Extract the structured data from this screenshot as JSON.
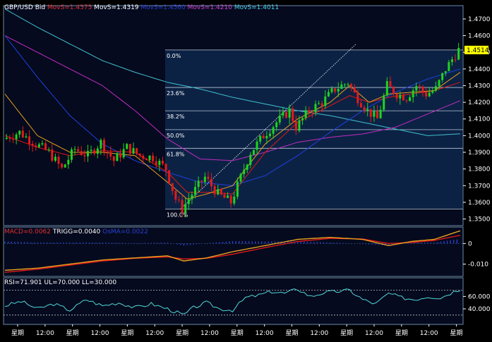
{
  "symbol": "GBP/USD Bid",
  "colors": {
    "background": "#000000",
    "panel_bg": "#050a1e",
    "fib_fill": "#0c2244",
    "grid": "#3a5a7a",
    "border": "#6a8aaa",
    "candle_up": "#1fd41f",
    "candle_down": "#e21b1b",
    "ma_fast": "#e8a020",
    "ma_mid": "#e01818",
    "ma_slow": "#2040e0",
    "ma_magenta": "#c02cc0",
    "ma_cyan": "#40c0d0",
    "macd_line": "#e8a020",
    "trigger_line": "#e01818",
    "osma_hist": "#2a40d0",
    "rsi_line": "#50d8d8",
    "trend_line": "#ffffff",
    "axis_text": "#ffffff",
    "price_tag_bg": "#ffff00"
  },
  "legend": {
    "main": [
      {
        "text": "GBP/USD Bid",
        "color": "#ffffff"
      },
      {
        "text": "MovS=1.4375",
        "color": "#e03030"
      },
      {
        "text": "MovS=1.4319",
        "color": "#ffffff"
      },
      {
        "text": "MovS=1.4560",
        "color": "#2a40d0"
      },
      {
        "text": "MovS=1.4210",
        "color": "#d040d0"
      },
      {
        "text": "MovS=1.4011",
        "color": "#50d0e0"
      }
    ],
    "macd": [
      {
        "text": "MACD=0.0062",
        "color": "#e03030"
      },
      {
        "text": "TRIGG=0.0040",
        "color": "#ffffff"
      },
      {
        "text": "OsMA=0.0022",
        "color": "#2a40d0"
      }
    ],
    "rsi": [
      {
        "text": "RSI=71.901",
        "color": "#ffffff"
      },
      {
        "text": "UL=70.000",
        "color": "#ffffff"
      },
      {
        "text": "LL=30.000",
        "color": "#ffffff"
      }
    ]
  },
  "last_price": "1.4514",
  "fib_levels": [
    {
      "label": "0.0%",
      "value": 1.4514
    },
    {
      "label": "23.6%",
      "value": 1.4289
    },
    {
      "label": "38.2%",
      "value": 1.4149
    },
    {
      "label": "50.0%",
      "value": 1.4036
    },
    {
      "label": "61.8%",
      "value": 1.3924
    },
    {
      "label": "100.0%",
      "value": 1.356
    }
  ],
  "x_axis_labels": [
    "星期",
    "12:00",
    "星期",
    "12:00",
    "星期",
    "12:00",
    "星期",
    "12:00",
    "星期",
    "12:00",
    "星期",
    "12:00",
    "星期",
    "12:00",
    "星期",
    "12:00",
    "星期"
  ],
  "chart_data": [
    {
      "type": "candlestick",
      "name": "price",
      "title": "GBP/USD Bid",
      "ylim": [
        1.346,
        1.478
      ],
      "y_ticks": [
        "1.4700",
        "1.4600",
        "1.4500",
        "1.4400",
        "1.4300",
        "1.4200",
        "1.4100",
        "1.4000",
        "1.3900",
        "1.3800",
        "1.3700",
        "1.3600",
        "1.3500"
      ],
      "bar_count": 130,
      "close_path": [
        [
          0,
          1.398
        ],
        [
          5,
          1.402
        ],
        [
          10,
          1.395
        ],
        [
          14,
          1.39
        ],
        [
          18,
          1.38
        ],
        [
          22,
          1.392
        ],
        [
          26,
          1.388
        ],
        [
          30,
          1.396
        ],
        [
          34,
          1.385
        ],
        [
          38,
          1.393
        ],
        [
          42,
          1.388
        ],
        [
          46,
          1.387
        ],
        [
          50,
          1.38
        ],
        [
          53,
          1.362
        ],
        [
          55,
          1.356
        ],
        [
          58,
          1.365
        ],
        [
          62,
          1.375
        ],
        [
          66,
          1.365
        ],
        [
          70,
          1.36
        ],
        [
          72,
          1.37
        ],
        [
          76,
          1.39
        ],
        [
          80,
          1.4
        ],
        [
          84,
          1.408
        ],
        [
          88,
          1.415
        ],
        [
          90,
          1.405
        ],
        [
          94,
          1.415
        ],
        [
          98,
          1.42
        ],
        [
          102,
          1.428
        ],
        [
          106,
          1.432
        ],
        [
          108,
          1.425
        ],
        [
          112,
          1.415
        ],
        [
          115,
          1.41
        ],
        [
          118,
          1.43
        ],
        [
          121,
          1.425
        ],
        [
          124,
          1.423
        ],
        [
          127,
          1.43
        ],
        [
          130,
          1.425
        ],
        [
          133,
          1.428
        ],
        [
          136,
          1.44
        ],
        [
          140,
          1.4514
        ]
      ],
      "moving_averages": [
        {
          "name": "MovS",
          "value": 1.4375,
          "path": [
            [
              0,
              1.425
            ],
            [
              10,
              1.4
            ],
            [
              20,
              1.39
            ],
            [
              30,
              1.39
            ],
            [
              40,
              1.388
            ],
            [
              50,
              1.372
            ],
            [
              56,
              1.362
            ],
            [
              62,
              1.365
            ],
            [
              70,
              1.37
            ],
            [
              80,
              1.395
            ],
            [
              90,
              1.41
            ],
            [
              100,
              1.42
            ],
            [
              106,
              1.43
            ],
            [
              112,
              1.42
            ],
            [
              118,
              1.425
            ],
            [
              125,
              1.426
            ],
            [
              132,
              1.427
            ],
            [
              140,
              1.438
            ]
          ]
        },
        {
          "name": "MovS",
          "value": 1.4319,
          "path": [
            [
              0,
              1.4
            ],
            [
              10,
              1.393
            ],
            [
              20,
              1.388
            ],
            [
              30,
              1.391
            ],
            [
              40,
              1.39
            ],
            [
              50,
              1.378
            ],
            [
              56,
              1.366
            ],
            [
              62,
              1.366
            ],
            [
              70,
              1.365
            ],
            [
              80,
              1.39
            ],
            [
              90,
              1.408
            ],
            [
              100,
              1.418
            ],
            [
              106,
              1.424
            ],
            [
              112,
              1.42
            ],
            [
              118,
              1.423
            ],
            [
              125,
              1.425
            ],
            [
              132,
              1.427
            ],
            [
              140,
              1.432
            ]
          ]
        },
        {
          "name": "MovS",
          "value": 1.456,
          "path": [
            [
              0,
              1.46
            ],
            [
              10,
              1.435
            ],
            [
              20,
              1.412
            ],
            [
              30,
              1.395
            ],
            [
              40,
              1.385
            ],
            [
              50,
              1.378
            ],
            [
              60,
              1.372
            ],
            [
              70,
              1.37
            ],
            [
              80,
              1.376
            ],
            [
              90,
              1.388
            ],
            [
              100,
              1.402
            ],
            [
              110,
              1.415
            ],
            [
              120,
              1.426
            ],
            [
              130,
              1.434
            ],
            [
              140,
              1.44
            ]
          ]
        },
        {
          "name": "MovS",
          "value": 1.421,
          "path": [
            [
              0,
              1.46
            ],
            [
              10,
              1.45
            ],
            [
              20,
              1.44
            ],
            [
              30,
              1.43
            ],
            [
              40,
              1.415
            ],
            [
              50,
              1.398
            ],
            [
              60,
              1.386
            ],
            [
              70,
              1.385
            ],
            [
              80,
              1.39
            ],
            [
              90,
              1.396
            ],
            [
              100,
              1.399
            ],
            [
              110,
              1.401
            ],
            [
              120,
              1.405
            ],
            [
              130,
              1.413
            ],
            [
              140,
              1.421
            ]
          ]
        },
        {
          "name": "MovS",
          "value": 1.4011,
          "path": [
            [
              0,
              1.476
            ],
            [
              10,
              1.465
            ],
            [
              20,
              1.455
            ],
            [
              30,
              1.445
            ],
            [
              40,
              1.438
            ],
            [
              50,
              1.432
            ],
            [
              60,
              1.428
            ],
            [
              70,
              1.423
            ],
            [
              80,
              1.419
            ],
            [
              90,
              1.415
            ],
            [
              100,
              1.412
            ],
            [
              110,
              1.408
            ],
            [
              120,
              1.404
            ],
            [
              130,
              1.4
            ],
            [
              140,
              1.4011
            ]
          ]
        }
      ],
      "fibonacci": {
        "high": 1.4514,
        "low": 1.356
      }
    },
    {
      "type": "line",
      "name": "MACD",
      "ylim": [
        -0.016,
        0.008
      ],
      "y_ticks": [
        "0",
        "-0.010"
      ],
      "series": [
        {
          "name": "MACD",
          "value": 0.0062,
          "path": [
            [
              0,
              -0.013
            ],
            [
              10,
              -0.012
            ],
            [
              20,
              -0.01
            ],
            [
              30,
              -0.008
            ],
            [
              40,
              -0.007
            ],
            [
              50,
              -0.006
            ],
            [
              55,
              -0.0085
            ],
            [
              62,
              -0.007
            ],
            [
              70,
              -0.004
            ],
            [
              80,
              -0.001
            ],
            [
              90,
              0.002
            ],
            [
              100,
              0.003
            ],
            [
              110,
              0.002
            ],
            [
              118,
              -0.001
            ],
            [
              125,
              0.001
            ],
            [
              132,
              0.002
            ],
            [
              140,
              0.0062
            ]
          ]
        },
        {
          "name": "TRIGG",
          "value": 0.004,
          "path": [
            [
              0,
              -0.014
            ],
            [
              10,
              -0.0125
            ],
            [
              20,
              -0.0105
            ],
            [
              30,
              -0.0085
            ],
            [
              40,
              -0.0072
            ],
            [
              50,
              -0.0065
            ],
            [
              55,
              -0.0075
            ],
            [
              62,
              -0.0072
            ],
            [
              70,
              -0.0052
            ],
            [
              80,
              -0.002
            ],
            [
              90,
              0.001
            ],
            [
              100,
              0.0025
            ],
            [
              110,
              0.0022
            ],
            [
              118,
              0.0
            ],
            [
              125,
              0.0005
            ],
            [
              132,
              0.0015
            ],
            [
              140,
              0.004
            ]
          ]
        },
        {
          "name": "OsMA",
          "value": 0.0022
        }
      ]
    },
    {
      "type": "line",
      "name": "RSI",
      "ylim": [
        15,
        90
      ],
      "y_ticks": [
        "60.000",
        "40.000"
      ],
      "upper_limit": 70,
      "lower_limit": 30,
      "series": [
        {
          "name": "RSI",
          "value": 71.901,
          "path": [
            [
              0,
              45
            ],
            [
              5,
              52
            ],
            [
              10,
              40
            ],
            [
              15,
              48
            ],
            [
              20,
              38
            ],
            [
              25,
              55
            ],
            [
              30,
              45
            ],
            [
              35,
              50
            ],
            [
              40,
              42
            ],
            [
              45,
              48
            ],
            [
              50,
              40
            ],
            [
              55,
              30
            ],
            [
              58,
              42
            ],
            [
              62,
              50
            ],
            [
              66,
              40
            ],
            [
              70,
              38
            ],
            [
              74,
              58
            ],
            [
              78,
              62
            ],
            [
              82,
              68
            ],
            [
              86,
              65
            ],
            [
              90,
              72
            ],
            [
              94,
              60
            ],
            [
              98,
              66
            ],
            [
              102,
              68
            ],
            [
              106,
              70
            ],
            [
              110,
              55
            ],
            [
              114,
              48
            ],
            [
              118,
              65
            ],
            [
              122,
              58
            ],
            [
              126,
              55
            ],
            [
              130,
              60
            ],
            [
              134,
              58
            ],
            [
              138,
              68
            ],
            [
              140,
              71.9
            ]
          ]
        }
      ]
    }
  ]
}
